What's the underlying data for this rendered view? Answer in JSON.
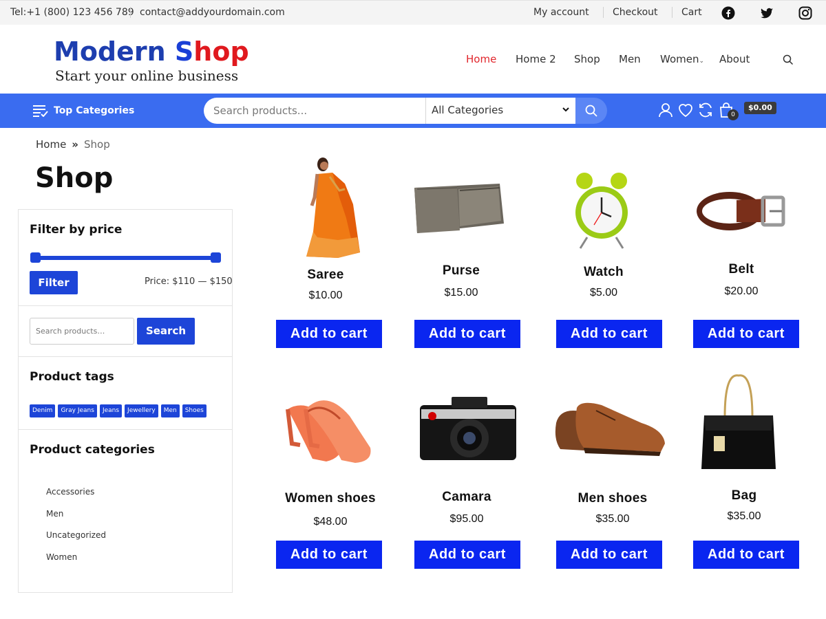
{
  "topbar": {
    "phone": "Tel:+1 (800) 123 456 789",
    "email": "contact@addyourdomain.com",
    "links": [
      "My account",
      "Checkout",
      "Cart"
    ],
    "social_icons": [
      "facebook-icon",
      "twitter-icon",
      "instagram-icon"
    ]
  },
  "header": {
    "logo_word1": "Modern",
    "logo_s": "S",
    "logo_rest": "hop",
    "tagline": "Start your online business",
    "nav": [
      "Home",
      "Home 2",
      "Shop",
      "Men",
      "Women",
      "About"
    ],
    "active_nav": "Home"
  },
  "bluebar": {
    "top_categories": "Top Categories",
    "search_placeholder": "Search products...",
    "category_select": "All Categories",
    "cart_count": "0",
    "cart_total": "$0.00"
  },
  "breadcrumb": {
    "home": "Home",
    "current": "Shop"
  },
  "page_title": "Shop",
  "sidebar": {
    "filter_heading": "Filter by price",
    "filter_button": "Filter",
    "price_range": "Price: $110 — $150",
    "search_placeholder": "Search products…",
    "search_button": "Search",
    "tags_heading": "Product tags",
    "tags": [
      "Denim",
      "Gray Jeans",
      "Jeans",
      "Jewellery",
      "Men",
      "Shoes"
    ],
    "categories_heading": "Product categories",
    "categories": [
      "Accessories",
      "Men",
      "Uncategorized",
      "Women"
    ]
  },
  "products": [
    {
      "name": "Saree",
      "price": "$10.00",
      "button": "Add to cart"
    },
    {
      "name": "Purse",
      "price": "$15.00",
      "button": "Add to cart"
    },
    {
      "name": "Watch",
      "price": "$5.00",
      "button": "Add to cart"
    },
    {
      "name": "Belt",
      "price": "$20.00",
      "button": "Add to cart"
    },
    {
      "name": "Women shoes",
      "price": "$48.00",
      "button": "Add to cart"
    },
    {
      "name": "Camara",
      "price": "$95.00",
      "button": "Add to cart"
    },
    {
      "name": "Men shoes",
      "price": "$35.00",
      "button": "Add to cart"
    },
    {
      "name": "Bag",
      "price": "$35.00",
      "button": "Add to cart"
    }
  ],
  "colors": {
    "accent_blue": "#3a6cf0",
    "button_blue": "#0a26f0",
    "sidebar_blue": "#1d45d8",
    "active_red": "#e1262c"
  }
}
